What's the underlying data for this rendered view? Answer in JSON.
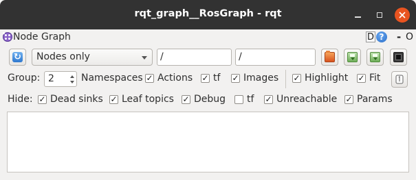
{
  "window": {
    "title": "rqt_graph__RosGraph - rqt"
  },
  "dock": {
    "title": "Node Graph",
    "d_label": "D",
    "help_label": "?",
    "minimize_label": "-",
    "close_label": "O"
  },
  "toolbar": {
    "filter_mode": "Nodes only",
    "node_filter_value": "/",
    "topic_filter_value": "/"
  },
  "options_row": {
    "group_label": "Group:",
    "group_value": "2",
    "checkboxes": [
      {
        "label": "Namespaces",
        "checked": false
      },
      {
        "label": "Actions",
        "checked": true
      },
      {
        "label": "tf",
        "checked": true
      },
      {
        "label": "Images",
        "checked": true
      },
      {
        "label": "Highlight",
        "checked": true
      },
      {
        "label": "Fit",
        "checked": true
      }
    ]
  },
  "hide_row": {
    "label": "Hide:",
    "checkboxes": [
      {
        "label": "Dead sinks",
        "checked": true
      },
      {
        "label": "Leaf topics",
        "checked": true
      },
      {
        "label": "Debug",
        "checked": true
      },
      {
        "label": "tf",
        "checked": false
      },
      {
        "label": "Unreachable",
        "checked": true
      },
      {
        "label": "Params",
        "checked": true
      }
    ]
  },
  "check_mark": "✓"
}
